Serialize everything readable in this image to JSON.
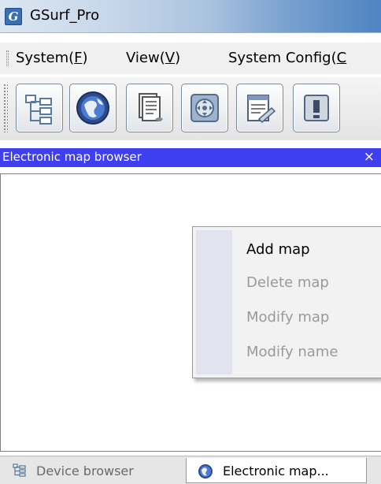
{
  "window": {
    "title": "GSurf_Pro",
    "app_icon": "gsurf-app-icon",
    "app_icon_glyph": "G"
  },
  "menubar": {
    "items": [
      {
        "label": "System(",
        "mnemonic": "F",
        "suffix": ")"
      },
      {
        "label": "View(",
        "mnemonic": "V",
        "suffix": ")"
      },
      {
        "label": "System Config(",
        "mnemonic": "C",
        "suffix": ""
      }
    ]
  },
  "toolbar": {
    "buttons": [
      {
        "icon": "device-tree-icon"
      },
      {
        "icon": "globe-icon"
      },
      {
        "icon": "device-list-icon"
      },
      {
        "icon": "ptz-control-icon"
      },
      {
        "icon": "notepad-edit-icon"
      },
      {
        "icon": "alarm-icon"
      }
    ]
  },
  "panel": {
    "title": "Electronic map browser",
    "close_glyph": "×",
    "header_color": "#3f3ff2"
  },
  "context_menu": {
    "items": [
      {
        "label": "Add map",
        "enabled": true
      },
      {
        "label": "Delete map",
        "enabled": false
      },
      {
        "label": "Modify map",
        "enabled": false
      },
      {
        "label": "Modify name",
        "enabled": false
      }
    ]
  },
  "bottom_tabs": {
    "tabs": [
      {
        "label": "Device browser",
        "icon": "device-tree-icon",
        "active": false
      },
      {
        "label": "Electronic map...",
        "icon": "globe-icon",
        "active": true
      }
    ]
  }
}
